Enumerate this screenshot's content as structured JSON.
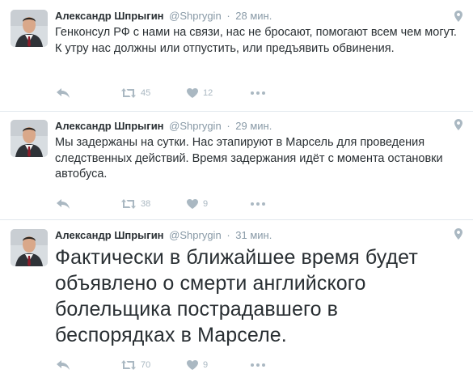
{
  "tweets": [
    {
      "author": "Александр Шпрыгин",
      "handle": "@Shprygin",
      "separator": "·",
      "time": "28 мин.",
      "text": "Генконсул РФ с нами на связи, нас не бросают, помогают всем чем могут. К утру нас должны или отпустить, или предъявить обвинения.",
      "retweets": "45",
      "likes": "12"
    },
    {
      "author": "Александр Шпрыгин",
      "handle": "@Shprygin",
      "separator": "·",
      "time": "29 мин.",
      "text": "Мы задержаны на сутки. Нас этапируют в Марсель для проведения следственных действий. Время задержания идёт с момента остановки автобуса.",
      "retweets": "38",
      "likes": "9"
    },
    {
      "author": "Александр Шпрыгин",
      "handle": "@Shprygin",
      "separator": "·",
      "time": "31 мин.",
      "text": "Фактически в ближайшее время будет объявлено о смерти английского болельщика пострадавшего в беспорядках в Марселе.",
      "retweets": "70",
      "likes": "9"
    }
  ],
  "icons": {
    "reply": "reply-icon",
    "retweet": "retweet-icon",
    "like": "heart-icon",
    "more": "more-icon",
    "location": "location-pin-icon"
  },
  "colors": {
    "text": "#292f33",
    "meta": "#8899a6",
    "action": "#aab8c2",
    "divider": "#e1e8ed"
  }
}
